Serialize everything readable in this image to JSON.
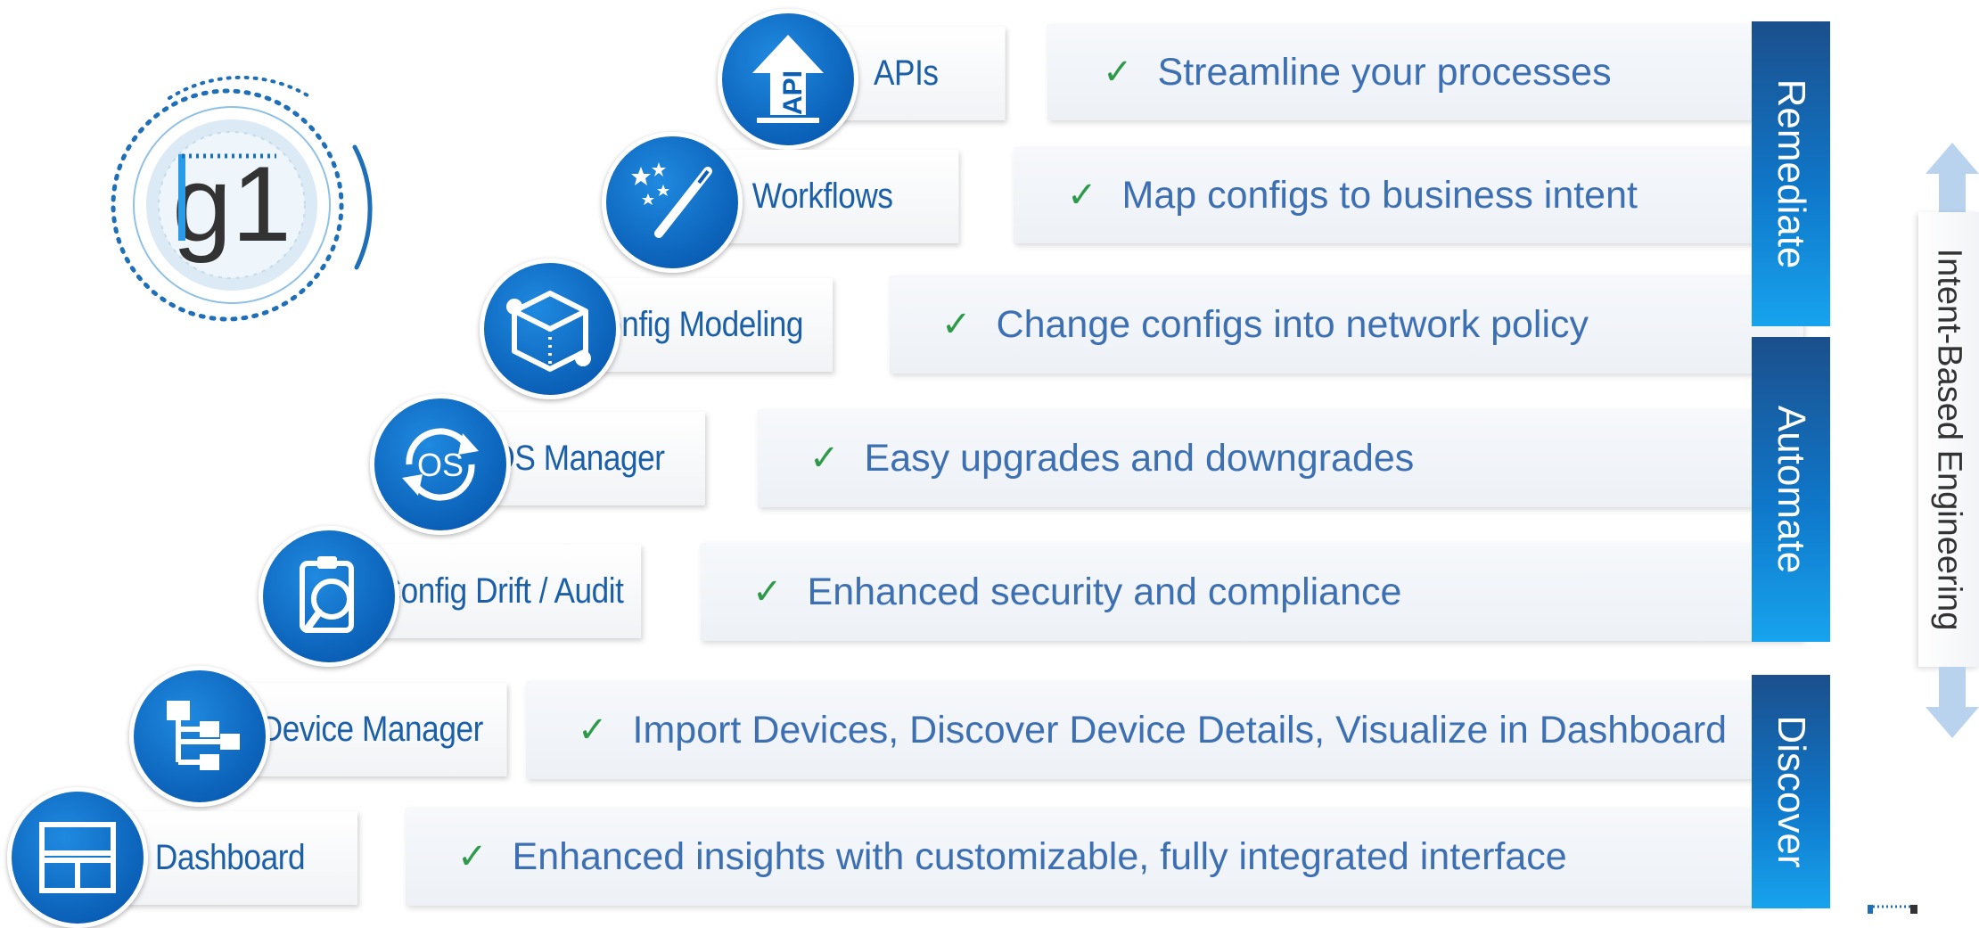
{
  "logo": {
    "text": "g1"
  },
  "rows": [
    {
      "label": "APIs",
      "description": "Streamline your processes",
      "icon": "api-upload-icon"
    },
    {
      "label": "Workflows",
      "description": "Map configs to business intent",
      "icon": "magic-wand-icon"
    },
    {
      "label": "Config Modeling",
      "description": "Change configs into network policy",
      "icon": "cube-model-icon"
    },
    {
      "label": "OS Manager",
      "description": "Easy upgrades and downgrades",
      "icon": "os-cycle-icon"
    },
    {
      "label": "Config Drift / Audit",
      "description": "Enhanced security and compliance",
      "icon": "clipboard-search-icon"
    },
    {
      "label": "Device Manager",
      "description": "Import Devices, Discover Device Details, Visualize in Dashboard",
      "icon": "hierarchy-icon"
    },
    {
      "label": "Dashboard",
      "description": "Enhanced insights with customizable, fully integrated interface",
      "icon": "dashboard-layout-icon"
    }
  ],
  "check_symbol": "✓",
  "phases": [
    {
      "label": "Remediate"
    },
    {
      "label": "Automate"
    },
    {
      "label": "Discover"
    }
  ],
  "side_label": "Intent-Based Engineering",
  "colors": {
    "primary_blue": "#0f6fc2",
    "label_text": "#1a5fa8",
    "description_text": "#3d6fb3",
    "check": "#2e9a4a",
    "arrow": "#b9d3ef"
  }
}
